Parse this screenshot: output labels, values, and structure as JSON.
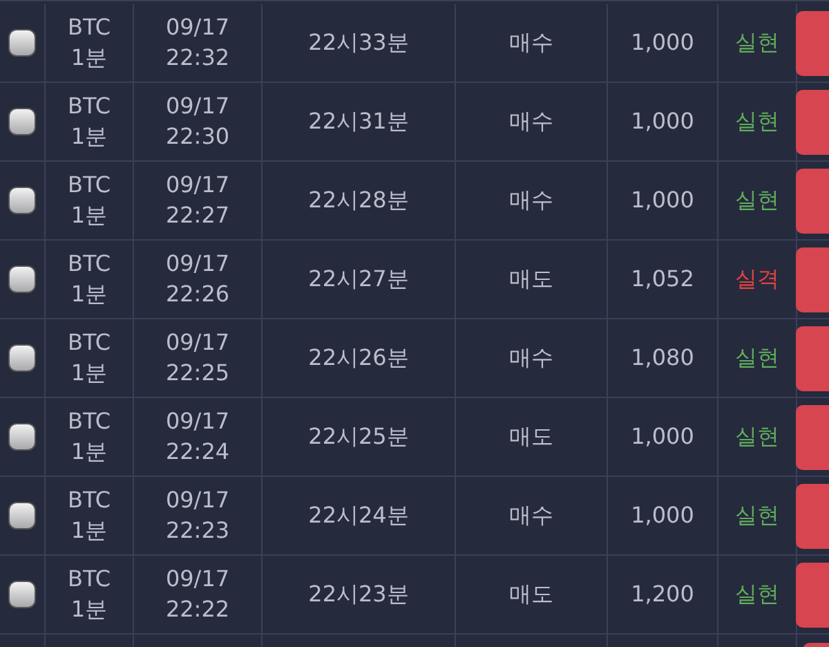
{
  "rows": [
    {
      "checked": false,
      "coin": "BTC",
      "interval": "1분",
      "date": "09/17",
      "time": "22:32",
      "round": "22시33분",
      "side": "매수",
      "amount": "1,000",
      "result": "실현",
      "kind": "win"
    },
    {
      "checked": false,
      "coin": "BTC",
      "interval": "1분",
      "date": "09/17",
      "time": "22:30",
      "round": "22시31분",
      "side": "매수",
      "amount": "1,000",
      "result": "실현",
      "kind": "win"
    },
    {
      "checked": false,
      "coin": "BTC",
      "interval": "1분",
      "date": "09/17",
      "time": "22:27",
      "round": "22시28분",
      "side": "매수",
      "amount": "1,000",
      "result": "실현",
      "kind": "win"
    },
    {
      "checked": false,
      "coin": "BTC",
      "interval": "1분",
      "date": "09/17",
      "time": "22:26",
      "round": "22시27분",
      "side": "매도",
      "amount": "1,052",
      "result": "실격",
      "kind": "loss"
    },
    {
      "checked": false,
      "coin": "BTC",
      "interval": "1분",
      "date": "09/17",
      "time": "22:25",
      "round": "22시26분",
      "side": "매수",
      "amount": "1,080",
      "result": "실현",
      "kind": "win"
    },
    {
      "checked": false,
      "coin": "BTC",
      "interval": "1분",
      "date": "09/17",
      "time": "22:24",
      "round": "22시25분",
      "side": "매도",
      "amount": "1,000",
      "result": "실현",
      "kind": "win"
    },
    {
      "checked": false,
      "coin": "BTC",
      "interval": "1분",
      "date": "09/17",
      "time": "22:23",
      "round": "22시24분",
      "side": "매수",
      "amount": "1,000",
      "result": "실현",
      "kind": "win"
    },
    {
      "checked": false,
      "coin": "BTC",
      "interval": "1분",
      "date": "09/17",
      "time": "22:22",
      "round": "22시23분",
      "side": "매도",
      "amount": "1,200",
      "result": "실현",
      "kind": "win"
    }
  ]
}
